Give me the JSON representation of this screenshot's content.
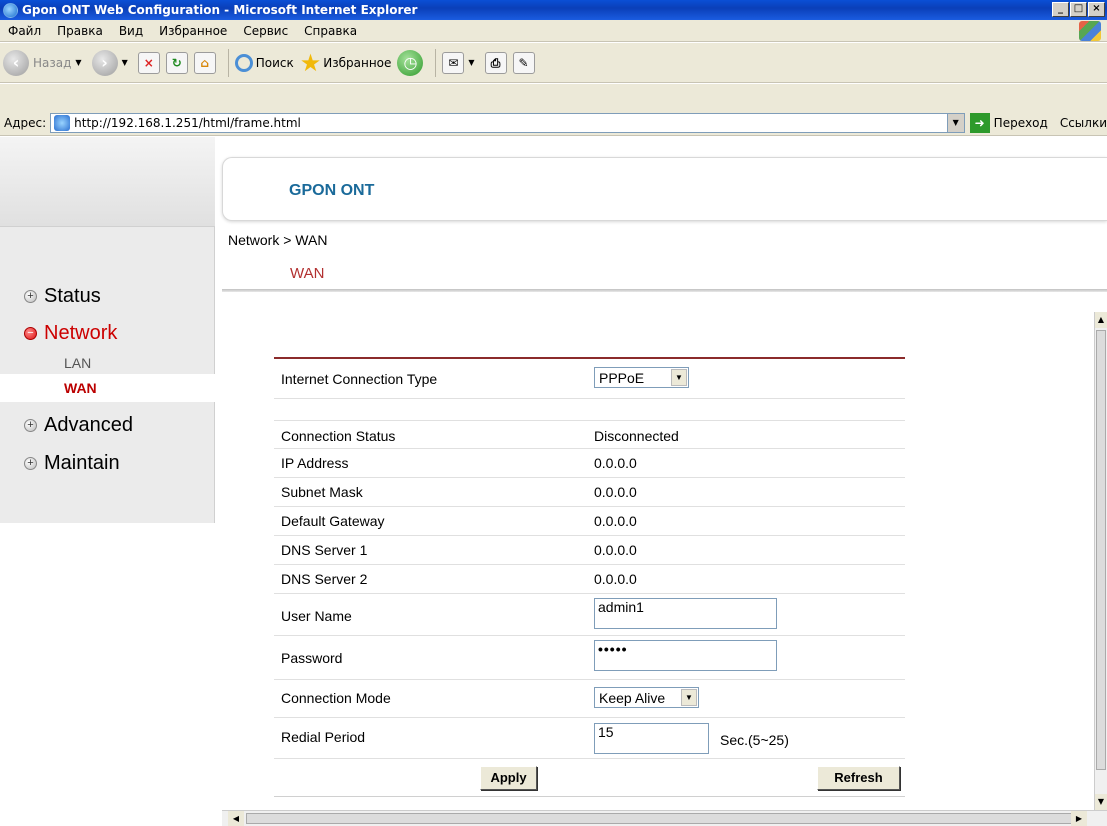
{
  "window": {
    "title": "Gpon ONT Web Configuration - Microsoft Internet Explorer",
    "min": "_",
    "max": "□",
    "close": "×"
  },
  "menu": [
    "Файл",
    "Правка",
    "Вид",
    "Избранное",
    "Сервис",
    "Справка"
  ],
  "toolbar": {
    "back": "Назад",
    "search": "Поиск",
    "favorites": "Избранное"
  },
  "address": {
    "label": "Адрес:",
    "url": "http://192.168.1.251/html/frame.html",
    "go": "Переход",
    "links": "Ссылки"
  },
  "brand": "GPON ONT",
  "breadcrumb": "Network > WAN",
  "page_tab": "WAN",
  "nav": {
    "status": "Status",
    "network": "Network",
    "lan": "LAN",
    "wan": "WAN",
    "advanced": "Advanced",
    "maintain": "Maintain"
  },
  "form": {
    "connection_type_label": "Internet Connection Type",
    "connection_type_value": "PPPoE",
    "rows": [
      {
        "label": "Connection Status",
        "value": "Disconnected"
      },
      {
        "label": "IP Address",
        "value": "0.0.0.0"
      },
      {
        "label": "Subnet Mask",
        "value": "0.0.0.0"
      },
      {
        "label": "Default Gateway",
        "value": "0.0.0.0"
      },
      {
        "label": "DNS Server 1",
        "value": "0.0.0.0"
      },
      {
        "label": "DNS Server 2",
        "value": "0.0.0.0"
      }
    ],
    "username_label": "User Name",
    "username_value": "admin1",
    "password_label": "Password",
    "password_value": "•••••",
    "mode_label": "Connection Mode",
    "mode_value": "Keep Alive",
    "redial_label": "Redial Period",
    "redial_value": "15",
    "redial_unit": "Sec.(5~25)",
    "apply": "Apply",
    "refresh": "Refresh"
  },
  "colors": {
    "accent": "#b23030",
    "brand": "#1a6a9a",
    "title_bar": "#0a4fd6"
  }
}
